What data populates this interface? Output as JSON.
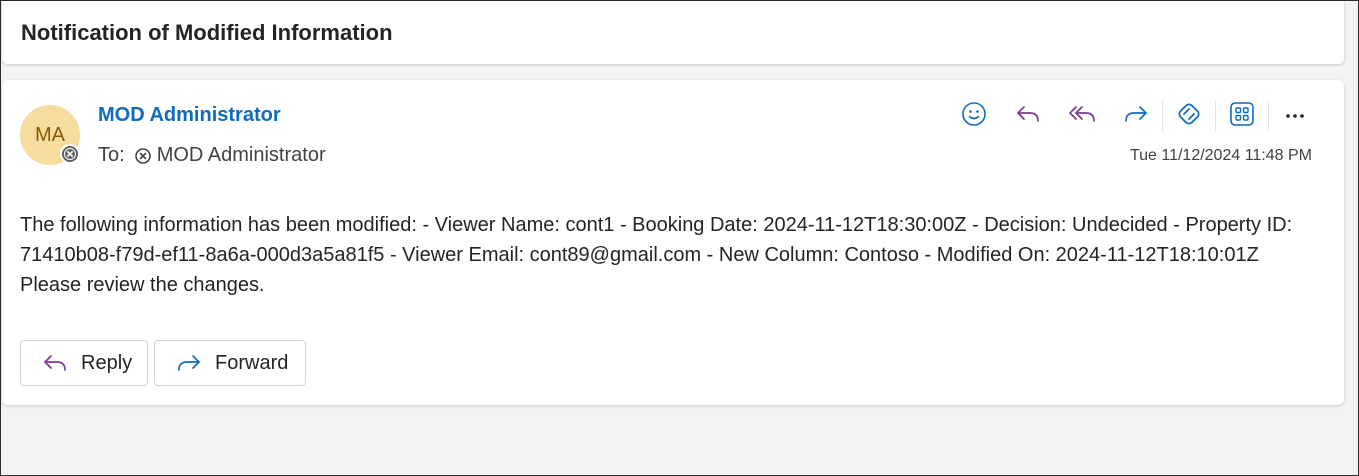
{
  "subject": "Notification of Modified Information",
  "message": {
    "avatar_initials": "MA",
    "sender_name": "MOD Administrator",
    "to_label": "To:",
    "recipient": "MOD Administrator",
    "timestamp": "Tue 11/12/2024 11:48 PM",
    "body": "The following information has been modified: - Viewer Name: cont1 - Booking Date: 2024-11-12T18:30:00Z - Decision: Undecided - Property ID: 71410b08-f79d-ef11-8a6a-000d3a5a81f5 - Viewer Email: cont89@gmail.com - New Column: Contoso - Modified On: 2024-11-12T18:10:01Z Please review the changes."
  },
  "toolbar": {
    "icons": [
      "emoji-icon",
      "reply-icon",
      "reply-all-icon",
      "forward-icon",
      "loop-icon",
      "apps-icon",
      "more-icon"
    ]
  },
  "actions": {
    "reply_label": "Reply",
    "forward_label": "Forward"
  },
  "colors": {
    "accent": "#0f6cbd",
    "reply_purple": "#7a3c8f",
    "avatar_bg": "#f7dca0",
    "avatar_text": "#8a5a00"
  }
}
